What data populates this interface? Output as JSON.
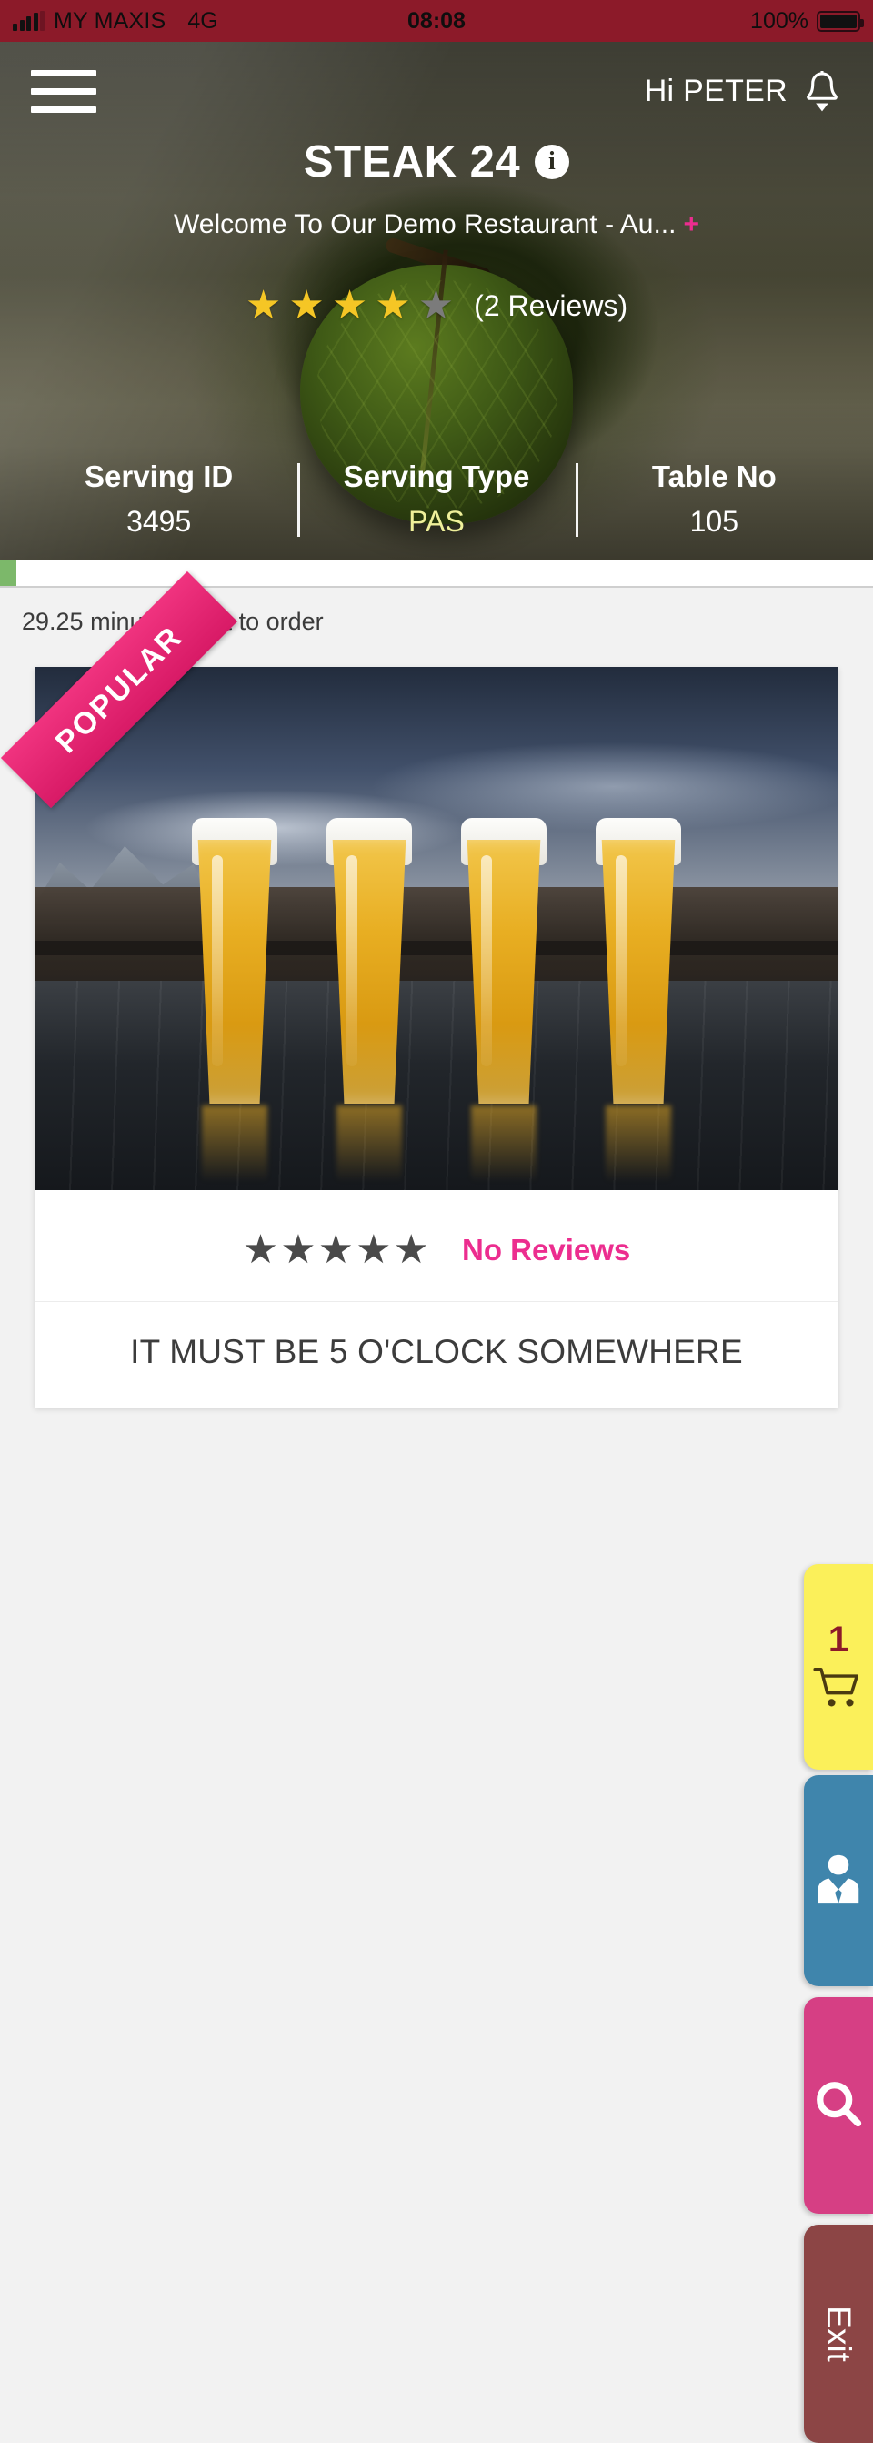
{
  "status_bar": {
    "carrier": "MY MAXIS",
    "network": "4G",
    "time": "08:08",
    "battery_pct": "100%",
    "bg_color": "#8c1a29"
  },
  "header": {
    "menu_icon": "hamburger-icon",
    "greeting": "Hi PETER",
    "bell_icon": "bell-icon"
  },
  "restaurant": {
    "name": "STEAK 24",
    "info_icon_label": "i",
    "tagline": "Welcome To Our Demo Restaurant - Au...",
    "tagline_expand": "+",
    "rating_value": 4,
    "rating_max": 5,
    "reviews_label": "(2 Reviews)",
    "star_filled_color": "#f5c625",
    "star_empty_color": "#7b7b7b",
    "accent_pink": "#ec2d8f"
  },
  "serving_info": [
    {
      "label": "Serving ID",
      "value": "3495",
      "highlight": false
    },
    {
      "label": "Serving Type",
      "value": "PAS",
      "highlight": true
    },
    {
      "label": "Table No",
      "value": "105",
      "highlight": false
    }
  ],
  "order_timer": {
    "text": "29.25 minute(s) left to order",
    "bar_color": "#7cb86a"
  },
  "menu_item": {
    "ribbon": "POPULAR",
    "ribbon_color": "#e8216b",
    "image_alt": "four-beer-glasses-on-table",
    "rating_value": 0,
    "rating_max": 5,
    "reviews_label": "No Reviews",
    "title": "IT MUST BE 5 O'CLOCK SOMEWHERE"
  },
  "side_tabs": {
    "cart": {
      "name": "cart-tab",
      "count": "1",
      "icon": "cart-icon",
      "color": "#fbf05a"
    },
    "waiter": {
      "name": "call-waiter-tab",
      "icon": "waiter-icon",
      "color": "#3f85ac"
    },
    "search": {
      "name": "search-tab",
      "icon": "search-icon",
      "color": "#d63f84"
    },
    "exit": {
      "name": "exit-tab",
      "label": "Exit",
      "color": "#8c4545"
    }
  }
}
